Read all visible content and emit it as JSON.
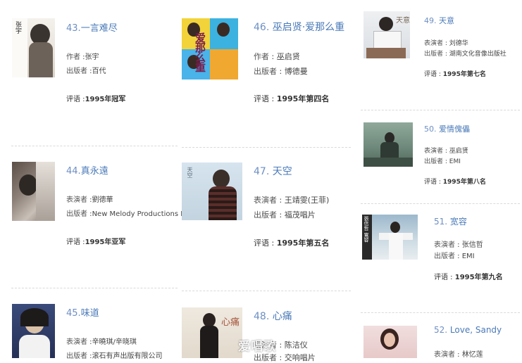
{
  "albums": [
    {
      "num": "43.",
      "title": "一言难尽",
      "performer_label": "作者",
      "performer": "张宇",
      "publisher_label": "出版者",
      "publisher": "百代",
      "rank_label": "评语",
      "rank": "1995年冠军",
      "cover_text": "张宇"
    },
    {
      "num": "46.",
      "title": "巫启贤·爱那么重",
      "performer_label": "作者",
      "performer": "巫启贤",
      "publisher_label": "出版者",
      "publisher": "博德曼",
      "rank_label": "评语",
      "rank": "1995年第四名",
      "cover_text": "爱那么重"
    },
    {
      "num": "49.",
      "title": "天意",
      "performer_label": "表演者",
      "performer": "刘德华",
      "publisher_label": "出版者",
      "publisher": "湖南文化音像出版社",
      "rank_label": "评语",
      "rank": "1995年第七名",
      "cover_text": "天意"
    },
    {
      "num": "44.",
      "title": "真永遠",
      "performer_label": "表演者",
      "performer": "劉德華",
      "publisher_label": "出版者",
      "publisher": "New Melody Productions LTD",
      "rank_label": "评语",
      "rank": "1995年亚军",
      "cover_text": ""
    },
    {
      "num": "47.",
      "title": "天空",
      "performer_label": "表演者",
      "performer": "王靖雯(王菲)",
      "publisher_label": "出版者",
      "publisher": "福茂唱片",
      "rank_label": "评语",
      "rank": "1995年第五名",
      "cover_text": "天空"
    },
    {
      "num": "50.",
      "title": "爱情傀儡",
      "performer_label": "表演者",
      "performer": "巫启贤",
      "publisher_label": "出版者",
      "publisher": "EMI",
      "rank_label": "评语",
      "rank": "1995年第八名",
      "cover_text": ""
    },
    {
      "num": "51.",
      "title": "宽容",
      "performer_label": "表演者",
      "performer": "张信哲",
      "publisher_label": "出版者",
      "publisher": "EMI",
      "rank_label": "评语",
      "rank": "1995年第九名",
      "cover_text": "張信哲 寬容"
    },
    {
      "num": "45.",
      "title": "味道",
      "performer_label": "表演者",
      "performer": "辛曉琪/辛晓琪",
      "publisher_label": "出版者",
      "publisher": "滚石有声出版有限公司",
      "rank_label": "",
      "rank": "",
      "cover_text": ""
    },
    {
      "num": "48.",
      "title": "心痛",
      "performer_label": "表演者",
      "performer": "陈洁仪",
      "publisher_label": "出版者",
      "publisher": "交响唱片",
      "rank_label": "",
      "rank": "",
      "cover_text": "心痛"
    },
    {
      "num": "52.",
      "title": "Love, Sandy",
      "performer_label": "表演者",
      "performer": "林忆莲",
      "publisher_label": "",
      "publisher": "",
      "rank_label": "",
      "rank": "",
      "cover_text": ""
    }
  ],
  "watermark": "爱唱歌"
}
